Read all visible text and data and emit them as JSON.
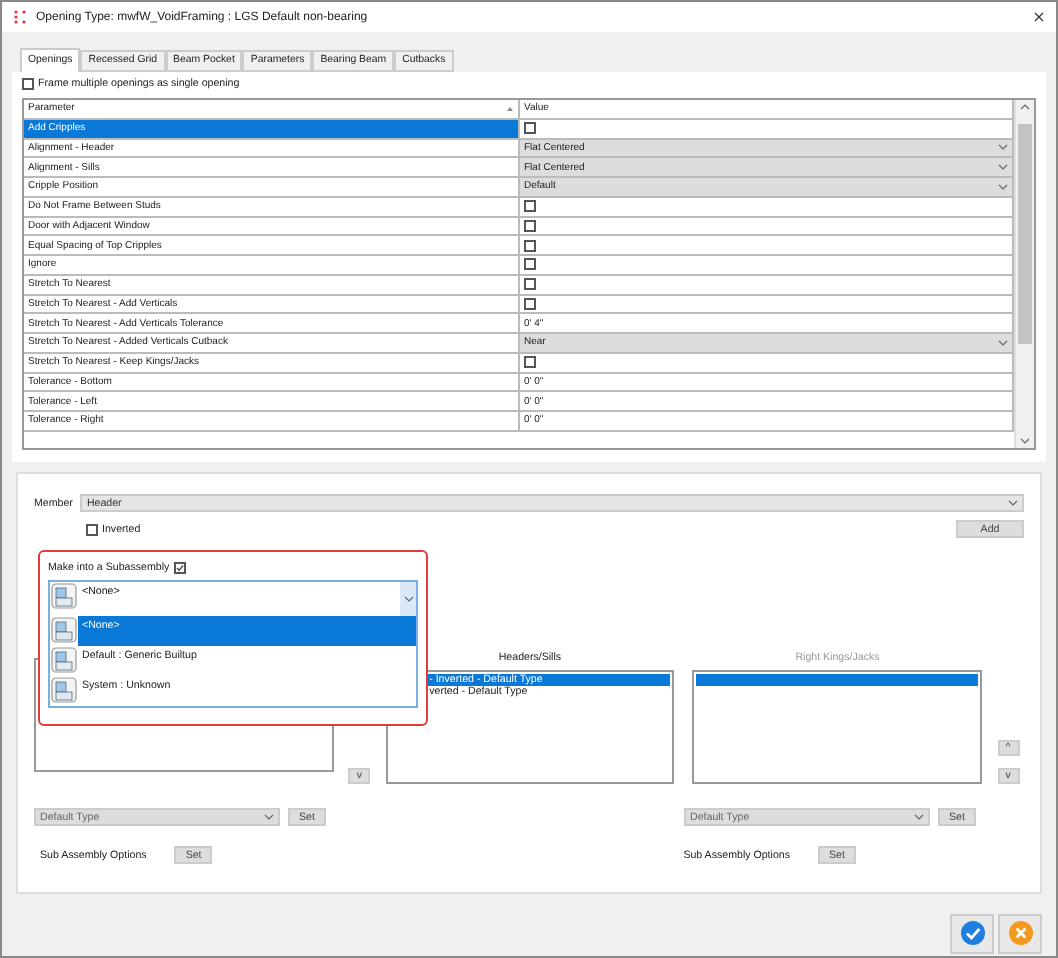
{
  "window": {
    "title": "Opening Type: mwfW_VoidFraming : LGS Default non-bearing"
  },
  "tabs": [
    {
      "label": "Openings",
      "selected": true
    },
    {
      "label": "Recessed Grid",
      "selected": false
    },
    {
      "label": "Beam Pocket",
      "selected": false
    },
    {
      "label": "Parameters",
      "selected": false
    },
    {
      "label": "Bearing Beam",
      "selected": false
    },
    {
      "label": "Cutbacks",
      "selected": false
    }
  ],
  "frame_multiple": {
    "label": "Frame multiple openings as single opening",
    "checked": false
  },
  "grid": {
    "columns": [
      "Parameter",
      "Value"
    ],
    "rows": [
      {
        "name": "Add Cripples",
        "kind": "checkbox",
        "checked": false,
        "selected": true
      },
      {
        "name": "Alignment - Header",
        "kind": "dropdown",
        "value": "Flat Centered",
        "selected": false
      },
      {
        "name": "Alignment - Sills",
        "kind": "dropdown",
        "value": "Flat Centered",
        "selected": false
      },
      {
        "name": "Cripple Position",
        "kind": "dropdown",
        "value": "Default",
        "selected": false
      },
      {
        "name": "Do Not Frame Between Studs",
        "kind": "checkbox",
        "checked": false,
        "selected": false
      },
      {
        "name": "Door with Adjacent Window",
        "kind": "checkbox",
        "checked": false,
        "selected": false
      },
      {
        "name": "Equal Spacing of Top Cripples",
        "kind": "checkbox",
        "checked": false,
        "selected": false
      },
      {
        "name": "Ignore",
        "kind": "checkbox",
        "checked": false,
        "selected": false
      },
      {
        "name": "Stretch To Nearest",
        "kind": "checkbox",
        "checked": false,
        "selected": false
      },
      {
        "name": "Stretch To Nearest - Add Verticals",
        "kind": "checkbox",
        "checked": false,
        "selected": false
      },
      {
        "name": "Stretch To Nearest - Add Verticals Tolerance",
        "kind": "text",
        "value": "0' 4\"",
        "selected": false
      },
      {
        "name": "Stretch To Nearest - Added Verticals Cutback",
        "kind": "dropdown",
        "value": "Near",
        "selected": false
      },
      {
        "name": "Stretch To Nearest - Keep Kings/Jacks",
        "kind": "checkbox",
        "checked": false,
        "selected": false
      },
      {
        "name": "Tolerance - Bottom",
        "kind": "text",
        "value": "0' 0\"",
        "selected": false
      },
      {
        "name": "Tolerance - Left",
        "kind": "text",
        "value": "0' 0\"",
        "selected": false
      },
      {
        "name": "Tolerance - Right",
        "kind": "text",
        "value": "0' 0\"",
        "selected": false
      }
    ]
  },
  "member": {
    "label": "Member",
    "value": "Header"
  },
  "inverted": {
    "label": "Inverted",
    "checked": false
  },
  "add_button": "Add",
  "subassembly": {
    "label": "Make into a Subassembly",
    "checked": true,
    "value": "<None>",
    "options": [
      {
        "label": "<None>",
        "selected": true
      },
      {
        "label": "Default : Generic Builtup",
        "selected": false
      },
      {
        "label": "System : Unknown",
        "selected": false
      }
    ]
  },
  "lists": [
    {
      "arrows": [
        "v"
      ]
    },
    {
      "title": "Headers/Sills",
      "disabled": false,
      "rows": [
        {
          "text": "- Inverted - Default Type",
          "selected": true
        },
        {
          "text": "verted - Default Type",
          "selected": false
        }
      ]
    },
    {
      "title": "Right Kings/Jacks",
      "disabled": true,
      "rows": [
        {
          "selected": true
        }
      ],
      "arrows": [
        "^",
        "v"
      ]
    }
  ],
  "type_selectors": [
    {
      "value": "Default Type",
      "button": "Set"
    },
    {
      "value": "Default Type",
      "button": "Set"
    }
  ],
  "sub_assembly_options": [
    {
      "label": "Sub Assembly Options",
      "button": "Set"
    },
    {
      "label": "Sub Assembly Options",
      "button": "Set"
    }
  ],
  "footer_buttons": [
    {
      "kind": "ok"
    },
    {
      "kind": "cancel"
    }
  ]
}
